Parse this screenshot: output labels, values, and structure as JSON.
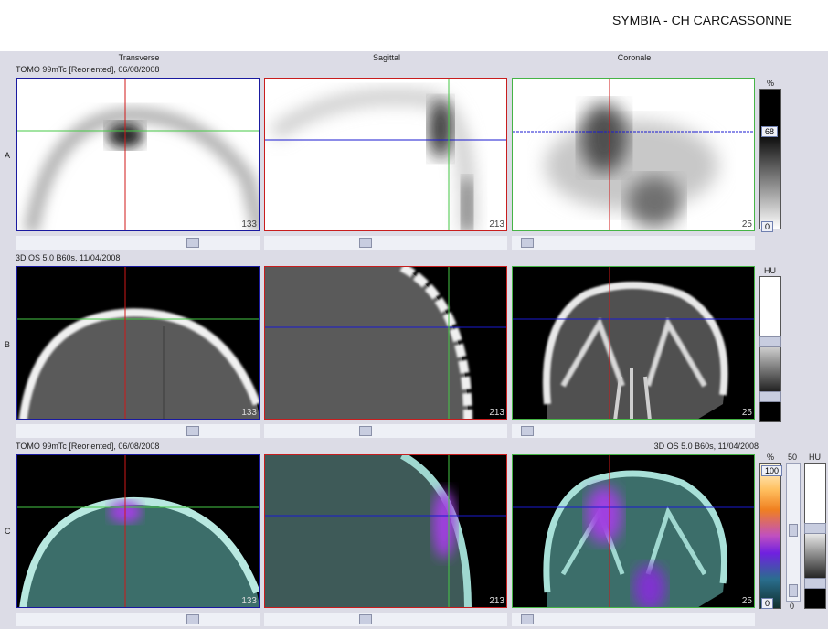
{
  "header": {
    "hospital": "SYMBIA - CH CARCASSONNE"
  },
  "columns": [
    "Transverse",
    "Sagittal",
    "Coronale"
  ],
  "rows": {
    "A": {
      "label": "A",
      "series": "TOMO 99mTc [Reoriented], 06/08/2008"
    },
    "B": {
      "label": "B",
      "series": "3D  OS  5.0  B60s, 11/04/2008"
    },
    "C": {
      "label": "C",
      "series_left": "TOMO 99mTc [Reoriented], 06/08/2008",
      "series_right": "3D  OS  5.0  B60s, 11/04/2008"
    }
  },
  "slices": {
    "transverse": "133",
    "sagittal": "213",
    "coronale": "25"
  },
  "scales": {
    "A": {
      "unit": "%",
      "value": "68",
      "min": "0"
    },
    "B": {
      "unit": "HU"
    },
    "C": {
      "unit_pct": "%",
      "max": "100",
      "min": "0",
      "mid": "50",
      "unit_hu": "HU",
      "zero": "0"
    }
  },
  "colors": {
    "frame_transverse": "#1a1aa0",
    "frame_sagittal": "#c81e1e",
    "frame_coronale": "#46b446",
    "crosshair_red": "#d01818",
    "crosshair_green": "#46c846",
    "crosshair_blue": "#1a1ad0",
    "background": "#dcdce6"
  }
}
